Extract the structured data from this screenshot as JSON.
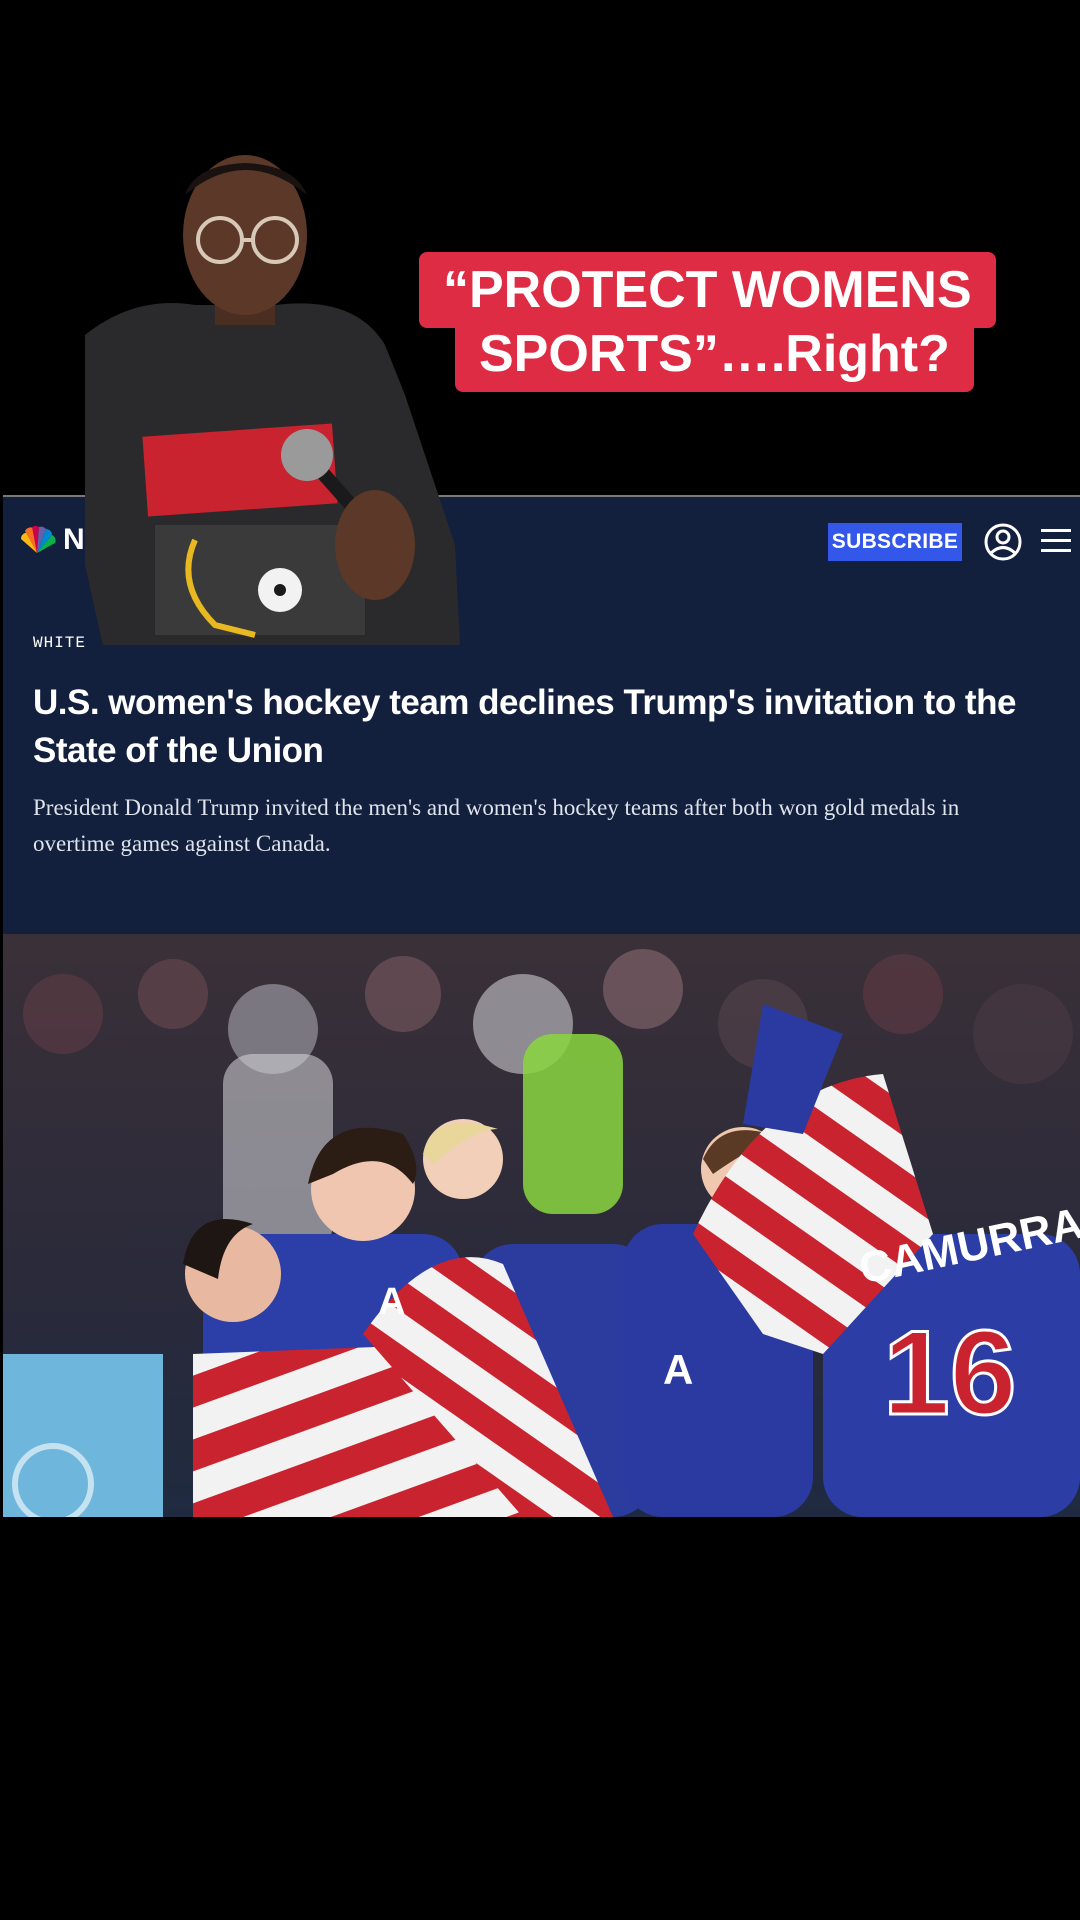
{
  "caption": {
    "line1": "“PROTECT WOMENS",
    "line2": "SPORTS”….Right?",
    "background": "#dd2c44"
  },
  "article": {
    "site_letter": "N",
    "logo_icon": "peacock-logo-icon",
    "subscribe_label": "SUBSCRIBE",
    "section_label": "WHITE",
    "headline": "U.S. women's hockey team declines Trump's invitation to the State of the Union",
    "dek": "President Donald Trump invited the men's and women's hockey teams after both won gold medals in overtime games against Canada.",
    "background": "#121f3d",
    "accent": "#3357e8",
    "photo": {
      "description_icon": "hockey-celebration-photo",
      "jersey_name": "CAMURRA",
      "jersey_number": "16"
    }
  },
  "presenter": {
    "icon": "person-with-microphone-icon"
  }
}
